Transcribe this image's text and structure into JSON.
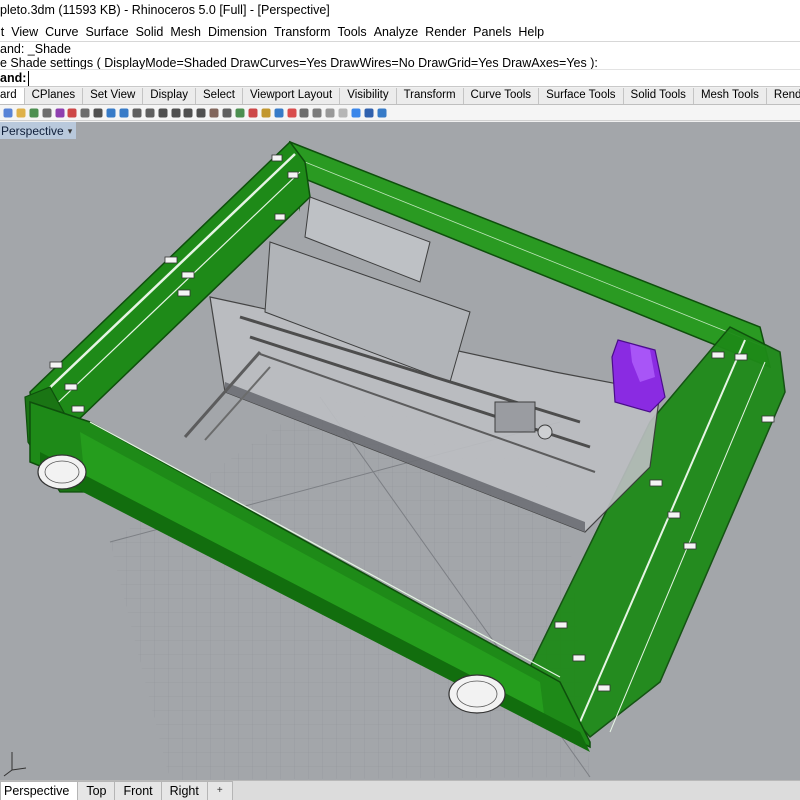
{
  "window": {
    "title": "pleto.3dm (11593 KB) - Rhinoceros 5.0 [Full] - [Perspective]"
  },
  "menu": [
    "it",
    "View",
    "Curve",
    "Surface",
    "Solid",
    "Mesh",
    "Dimension",
    "Transform",
    "Tools",
    "Analyze",
    "Render",
    "Panels",
    "Help"
  ],
  "command_history": {
    "line1": "and: _Shade",
    "line2": "e Shade settings ( DisplayMode=Shaded  DrawCurves=Yes  DrawWires=No  DrawGrid=Yes  DrawAxes=Yes ):"
  },
  "command_prompt": {
    "label": "and:",
    "value": ""
  },
  "toolbar_tabs": [
    "ard",
    "CPlanes",
    "Set View",
    "Display",
    "Select",
    "Viewport Layout",
    "Visibility",
    "Transform",
    "Curve Tools",
    "Surface Tools",
    "Solid Tools",
    "Mesh Tools",
    "Render"
  ],
  "active_toolbar_tab": "ard",
  "toolbar_icons": [
    "new-icon",
    "open-icon",
    "save-icon",
    "print-icon",
    "import-icon",
    "cut-icon",
    "copy-icon",
    "paste-icon",
    "undo-icon",
    "redo-icon",
    "pan-icon",
    "rotate-view-icon",
    "zoom-icon",
    "zoom-window-icon",
    "zoom-extents-icon",
    "zoom-selected-icon",
    "named-views-icon",
    "four-viewports-icon",
    "cplane-icon",
    "move-icon",
    "lock-icon",
    "hide-icon",
    "layer-icon",
    "properties-icon",
    "wireframe-icon",
    "shaded-icon",
    "rendered-icon",
    "material-icon",
    "render-icon",
    "help-icon"
  ],
  "viewport": {
    "label": "Perspective"
  },
  "view_tabs": [
    "Perspective",
    "Top",
    "Front",
    "Right"
  ],
  "active_view_tab": "Perspective",
  "add_view_icon": "+",
  "colors": {
    "frame_green": "#1e8a18",
    "frame_dark": "#0e4f0c",
    "motor_purple": "#8a2be2",
    "viewport_bg": "#a3a6aa",
    "viewport_label_bg": "#b9c9dc"
  }
}
